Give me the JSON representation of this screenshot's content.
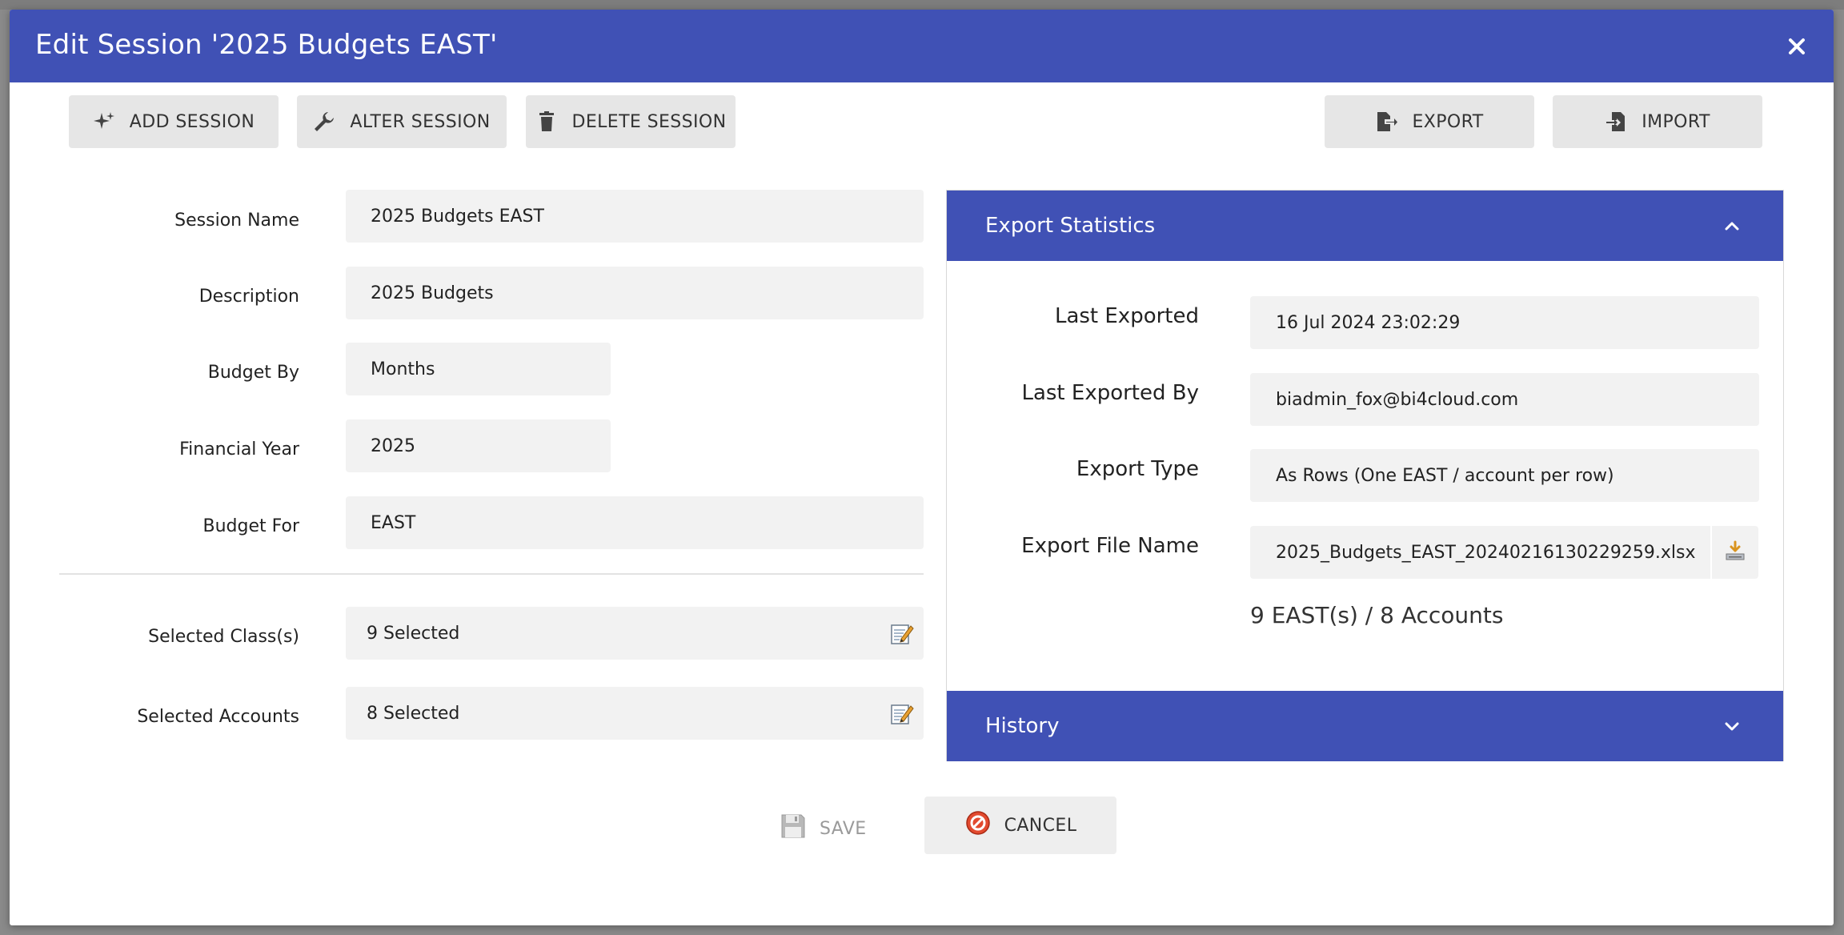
{
  "dialog": {
    "title": "Edit Session '2025 Budgets EAST'",
    "header_color": "#4051b5"
  },
  "toolbar": {
    "add_session": "ADD SESSION",
    "alter_session": "ALTER SESSION",
    "delete_session": "DELETE SESSION",
    "export": "EXPORT",
    "import": "IMPORT"
  },
  "form": {
    "session_name": {
      "label": "Session Name",
      "value": "2025 Budgets EAST"
    },
    "description": {
      "label": "Description",
      "value": "2025 Budgets"
    },
    "budget_by": {
      "label": "Budget By",
      "value": "Months"
    },
    "financial_year": {
      "label": "Financial Year",
      "value": "2025"
    },
    "budget_for": {
      "label": "Budget For",
      "value": "EAST"
    },
    "selected_classes": {
      "label": "Selected Class(s)",
      "value": "9 Selected"
    },
    "selected_accounts": {
      "label": "Selected Accounts",
      "value": "8 Selected"
    }
  },
  "export_stats": {
    "title": "Export Statistics",
    "expanded": true,
    "last_exported": {
      "label": "Last Exported",
      "value": "16 Jul 2024 23:02:29"
    },
    "last_exported_by": {
      "label": "Last Exported By",
      "value": "biadmin_fox@bi4cloud.com"
    },
    "export_type": {
      "label": "Export Type",
      "value": "As Rows (One EAST / account per row)"
    },
    "export_file_name": {
      "label": "Export File Name",
      "value": "2025_Budgets_EAST_20240216130229259.xlsx"
    },
    "summary": "9 EAST(s) / 8 Accounts"
  },
  "history": {
    "title": "History",
    "expanded": false
  },
  "footer": {
    "save": "SAVE",
    "cancel": "CANCEL"
  }
}
